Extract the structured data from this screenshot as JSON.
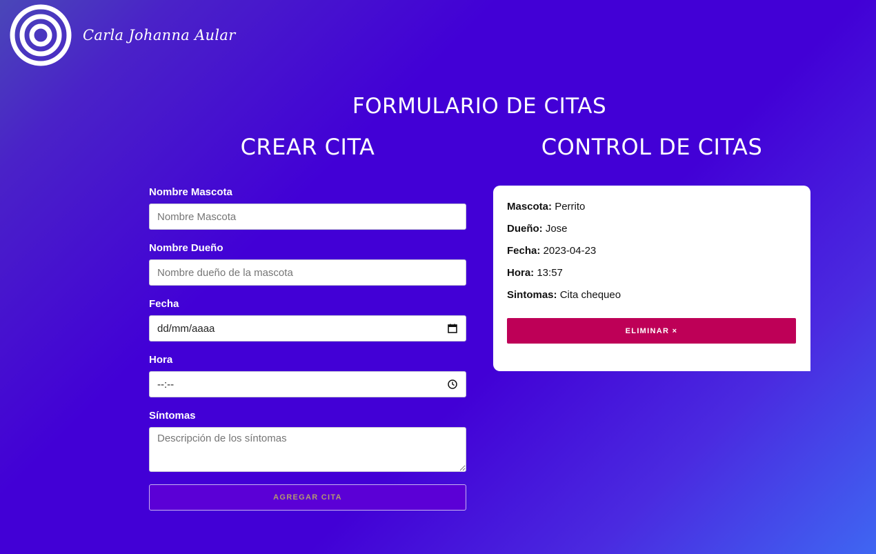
{
  "brand": {
    "name": "Carla Johanna Aular",
    "logo_icon": "concentric-circles-logo"
  },
  "page": {
    "title": "FORMULARIO DE CITAS"
  },
  "form_section": {
    "title": "CREAR CITA",
    "fields": {
      "pet_name": {
        "label": "Nombre Mascota",
        "placeholder": "Nombre Mascota",
        "value": ""
      },
      "owner_name": {
        "label": "Nombre Dueño",
        "placeholder": "Nombre dueño de la mascota",
        "value": ""
      },
      "date": {
        "label": "Fecha",
        "placeholder": "dd/mm/aaaa",
        "value": "",
        "icon": "calendar-icon"
      },
      "time": {
        "label": "Hora",
        "placeholder": "--:--",
        "value": "",
        "icon": "clock-icon"
      },
      "symptoms": {
        "label": "Síntomas",
        "placeholder": "Descripción de los síntomas",
        "value": ""
      }
    },
    "submit_label": "AGREGAR CITA"
  },
  "control_section": {
    "title": "CONTROL DE CITAS",
    "appointment": {
      "pet_label": "Mascota:",
      "pet": "Perrito",
      "owner_label": "Dueño:",
      "owner": "Jose",
      "date_label": "Fecha:",
      "date": "2023-04-23",
      "time_label": "Hora:",
      "time": "13:57",
      "symptoms_label": "Sintomas:",
      "symptoms": "Cita chequeo",
      "delete_label": "ELIMINAR ×"
    }
  },
  "colors": {
    "background_start": "#4a47b8",
    "background_main": "#4200d6",
    "background_end": "#3f66f2",
    "submit_button": "#5b00d6",
    "delete_button": "#be0057",
    "card": "#ffffff"
  }
}
